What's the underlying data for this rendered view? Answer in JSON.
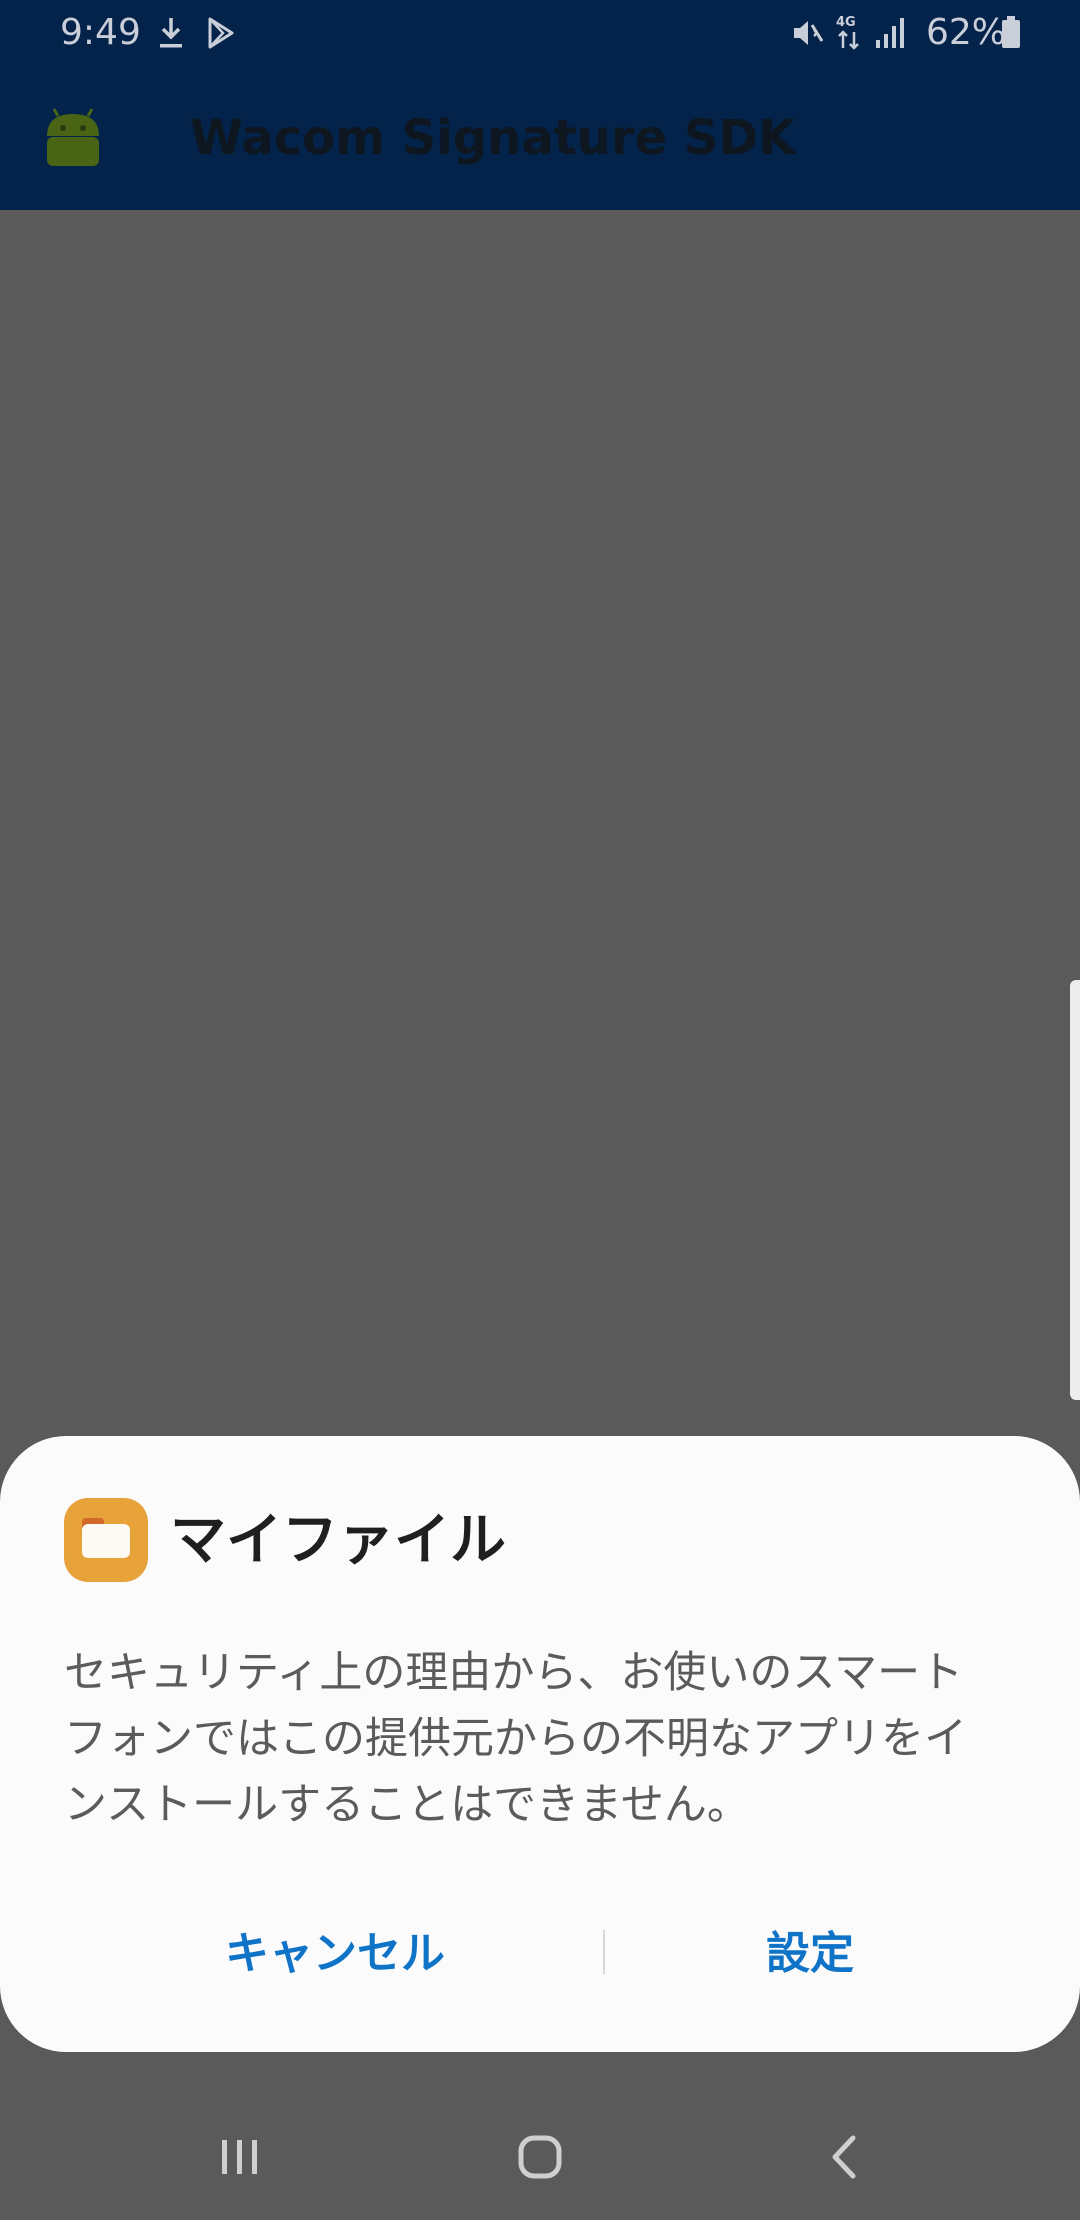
{
  "status_bar": {
    "time": "9:49",
    "battery": "62%",
    "icons": [
      "download-icon",
      "play-store-icon",
      "mute-icon",
      "4g-data-icon",
      "signal-icon",
      "battery-icon"
    ]
  },
  "app_bar": {
    "title": "Wacom Signature SDK",
    "icon": "android-icon"
  },
  "dialog": {
    "app_name": "マイファイル",
    "app_icon": "my-files-folder-icon",
    "message": "セキュリティ上の理由から、お使いのスマート\nフォンではこの提供元からの不明なアプリをイ\nンストールすることはできません。",
    "cancel_label": "キャンセル",
    "settings_label": "設定",
    "accent_color": "#0f73c8"
  },
  "nav_bar": {
    "buttons": [
      "recents-icon",
      "home-icon",
      "back-icon"
    ]
  },
  "colors": {
    "status_bar": "#03234a",
    "scrim": "#5a5a5a",
    "dialog_bg": "#fbfbfb"
  }
}
